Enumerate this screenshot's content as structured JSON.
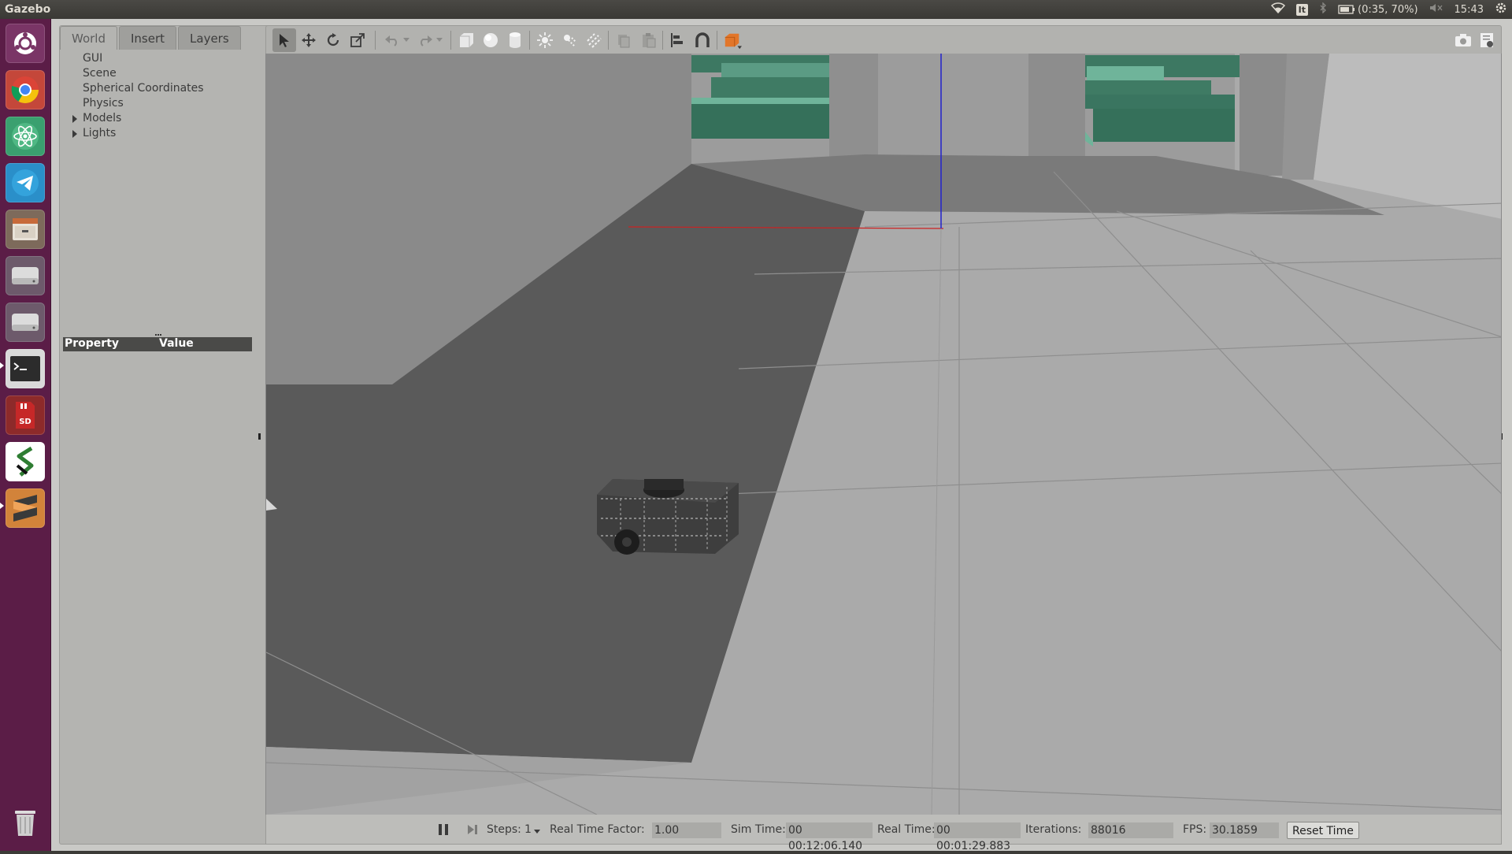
{
  "panel": {
    "app_title": "Gazebo",
    "lang": "It",
    "battery": "(0:35, 70%)",
    "clock": "15:43"
  },
  "launcher": {
    "items": [
      "dash-home-icon",
      "chrome-icon",
      "atom-icon",
      "telegram-icon",
      "files-icon",
      "disk-icon",
      "disk-icon-2",
      "terminal-icon",
      "sd-card-icon",
      "app-s-icon",
      "sublime-icon",
      "trash-icon"
    ]
  },
  "left_panel": {
    "tabs": [
      "World",
      "Insert",
      "Layers"
    ],
    "active_tab": "World",
    "tree": [
      "GUI",
      "Scene",
      "Spherical Coordinates",
      "Physics",
      "Models",
      "Lights"
    ],
    "property_header": {
      "property": "Property",
      "value": "Value"
    }
  },
  "bottom_bar": {
    "steps_label": "Steps:",
    "steps_value": "1",
    "rtf_label": "Real Time Factor:",
    "rtf_value": "1.00",
    "sim_time_label": "Sim Time:",
    "sim_time_value": "00 00:12:06.140",
    "real_time_label": "Real Time:",
    "real_time_value": "00 00:01:29.883",
    "iterations_label": "Iterations:",
    "iterations_value": "88016",
    "fps_label": "FPS:",
    "fps_value": "30.1859",
    "reset_label": "Reset Time"
  },
  "colors": {
    "launcher_bg": "#5b1d47",
    "ground": "#a4a4a4",
    "shadow": "#555555",
    "maze_green": "#3a6e5c",
    "axis_red": "#cc2222",
    "axis_blue": "#2222cc"
  }
}
